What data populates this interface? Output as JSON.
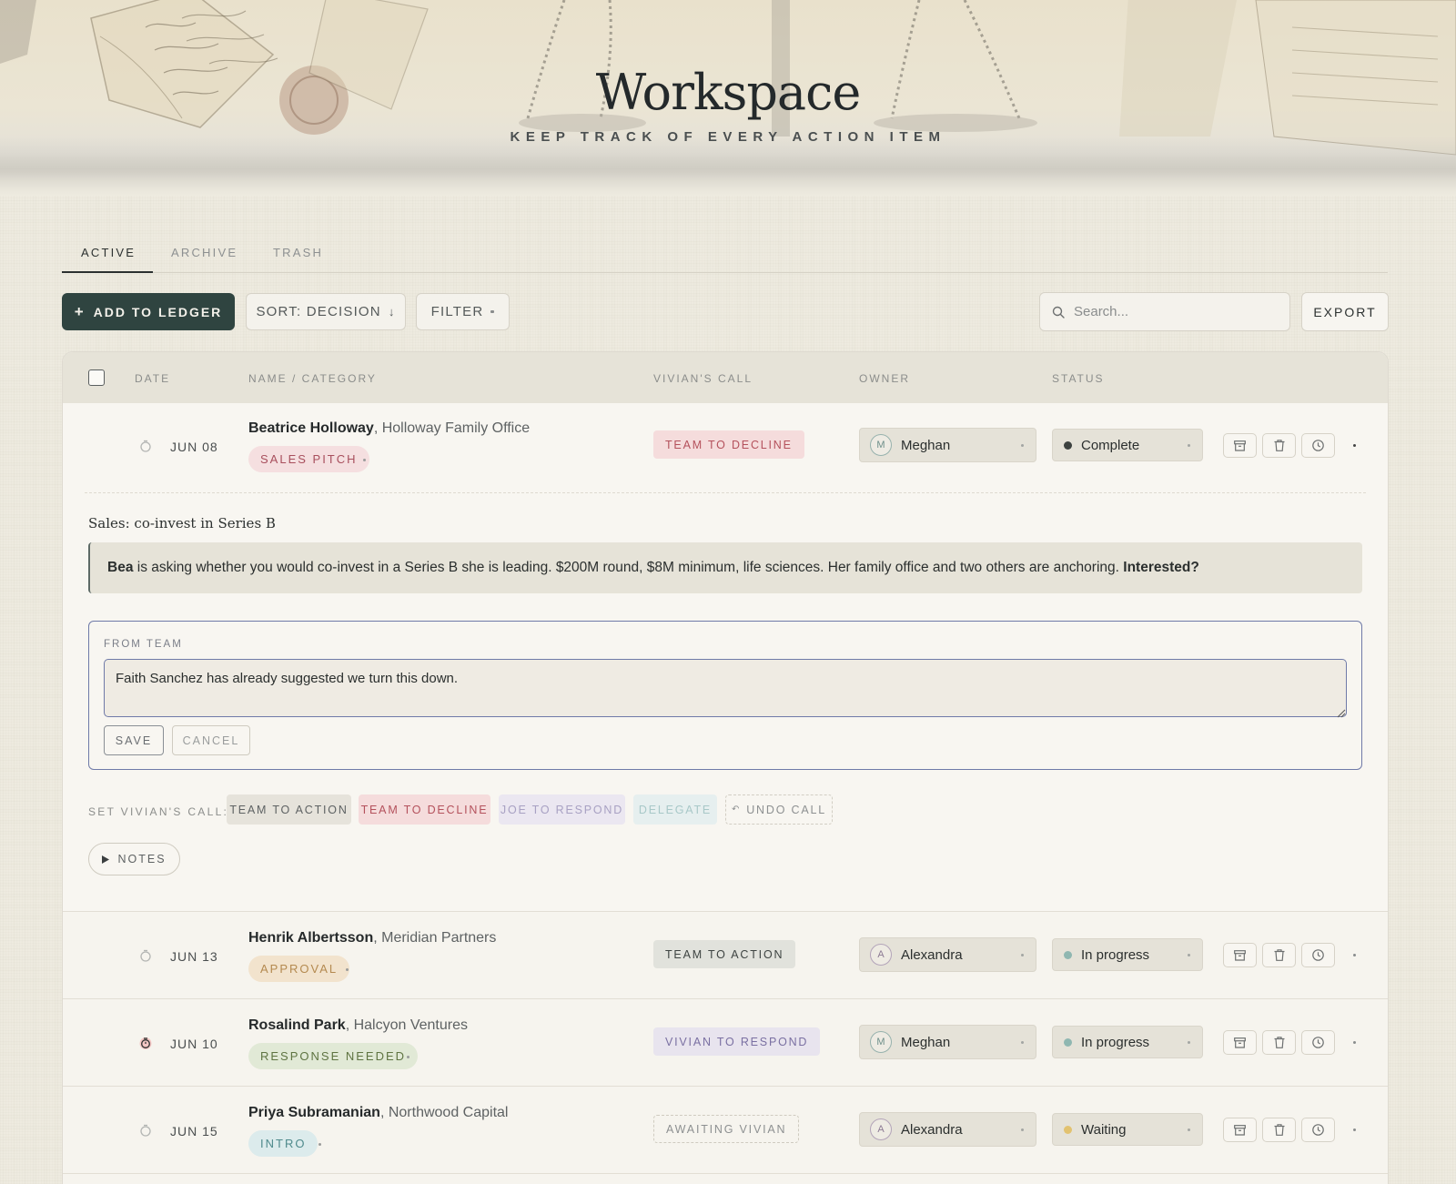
{
  "header": {
    "title": "Workspace",
    "subtitle": "KEEP TRACK OF EVERY ACTION ITEM"
  },
  "tabs": [
    {
      "label": "ACTIVE",
      "active": true
    },
    {
      "label": "ARCHIVE",
      "active": false
    },
    {
      "label": "TRASH",
      "active": false
    }
  ],
  "toolbar": {
    "add_label": "ADD TO LEDGER",
    "add_symbol": "+",
    "sort_label": "SORT: DECISION",
    "sort_arrow": "↓",
    "filter_label": "FILTER",
    "search_placeholder": "Search...",
    "export_label": "EXPORT"
  },
  "table": {
    "columns": [
      "DATE",
      "NAME / CATEGORY",
      "VIVIAN'S CALL",
      "OWNER",
      "STATUS"
    ],
    "rows": [
      {
        "date": "JUN 08",
        "name": "Beatrice Holloway",
        "org": ", Holloway Family Office",
        "category": "SALES PITCH",
        "call": "TEAM TO DECLINE",
        "owner": "Meghan",
        "owner_initial": "M",
        "status": "Complete",
        "status_color": "#3d4240"
      },
      {
        "date": "JUN 13",
        "name": "Henrik Albertsson",
        "org": ", Meridian Partners",
        "category": "APPROVAL",
        "call": "TEAM TO ACTION",
        "owner": "Alexandra",
        "owner_initial": "A",
        "status": "In progress",
        "status_color": "#8fb7b1"
      },
      {
        "date": "JUN 10",
        "name": "Rosalind Park",
        "org": ", Halcyon Ventures",
        "category": "RESPONSE NEEDED",
        "call": "VIVIAN TO RESPOND",
        "owner": "Meghan",
        "owner_initial": "M",
        "status": "In progress",
        "status_color": "#8fb7b1"
      },
      {
        "date": "JUN 15",
        "name": "Priya Subramanian",
        "org": ", Northwood Capital",
        "category": "INTRO",
        "call": "AWAITING VIVIAN",
        "owner": "Alexandra",
        "owner_initial": "A",
        "status": "Waiting",
        "status_color": "#e2c270"
      }
    ]
  },
  "detail": {
    "title": "Sales: co-invest in Series B",
    "summary_name": "Bea",
    "summary_text": " is asking whether you would co-invest in a Series B she is leading. $200M round, $8M minimum, life sciences. Her family office and two others are anchoring. ",
    "summary_question": "Interested?",
    "from_team_label": "FROM TEAM",
    "from_team_text": "Faith Sanchez has already suggested we turn this down.",
    "save_label": "SAVE",
    "cancel_label": "CANCEL",
    "set_call_label": "SET VIVIAN'S CALL:",
    "call_options": [
      "TEAM TO ACTION",
      "TEAM TO DECLINE",
      "JOE TO RESPOND",
      "DELEGATE",
      "UNDO CALL"
    ],
    "notes_label": "NOTES"
  },
  "colors": {
    "accent": "#2f4440",
    "background": "#eeebe0",
    "header_row": "#e6e3d8"
  }
}
